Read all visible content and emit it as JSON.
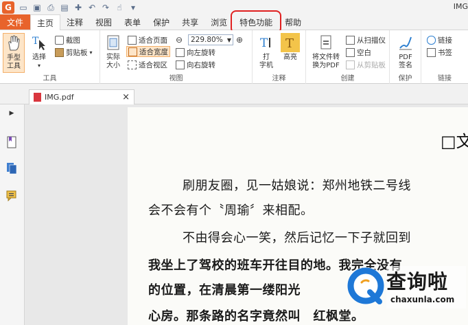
{
  "window": {
    "title": "IMG"
  },
  "quick_access": {
    "icons": [
      "app-logo-icon",
      "open-icon",
      "save-icon",
      "print-icon",
      "scan-icon",
      "new-icon",
      "undo-icon",
      "redo-icon",
      "hand-icon",
      "customize-icon"
    ]
  },
  "menu": {
    "file": "文件",
    "tabs": [
      "主页",
      "注释",
      "视图",
      "表单",
      "保护",
      "共享",
      "浏览",
      "特色功能",
      "帮助"
    ]
  },
  "ribbon": {
    "tools": {
      "hand": "手型\n工具",
      "select": "选择",
      "snapshot": "截图",
      "clipboard": "剪贴板",
      "label": "工具"
    },
    "view": {
      "actual_size": "实际\n大小",
      "fit_page": "适合页面",
      "fit_width": "适合宽度",
      "fit_view": "适合视区",
      "zoom": "229.80%",
      "rotate_left": "向左旋转",
      "rotate_right": "向右旋转",
      "label": "视图"
    },
    "comment": {
      "typewriter": "打\n字机",
      "highlight": "高亮",
      "label": "注释"
    },
    "create": {
      "to_pdf": "将文件转\n换为PDF",
      "from_scanner": "从扫描仪",
      "blank": "空白",
      "from_clipboard": "从剪贴板",
      "label": "创建"
    },
    "protect": {
      "pdf_sign": "PDF\n签名",
      "label": "保护"
    },
    "links": {
      "link": "链接",
      "bookmark": "书签",
      "label": "链接"
    }
  },
  "doc_tab": {
    "name": "IMG.pdf"
  },
  "document": {
    "heading": "□文",
    "lines": [
      "刷朋友圈，见一姑娘说：郑州地铁二号线",
      "会不会有个〝周瑜〞来相配。",
      "不由得会心一笑，然后记忆一下子就回到",
      "我坐上了驾校的班车开往目的地。我完全没有",
      "的位置，在清晨第一缕阳光",
      "心房。那条路的名字竟然叫　红枫堂。"
    ]
  },
  "watermark": {
    "brand": "查询啦",
    "url": "chaxunla.com"
  },
  "colors": {
    "accent": "#e8632b",
    "highlight_ring": "#e02020",
    "selected_bg": "#fde5c8",
    "watermark_blue": "#1e78d7"
  }
}
